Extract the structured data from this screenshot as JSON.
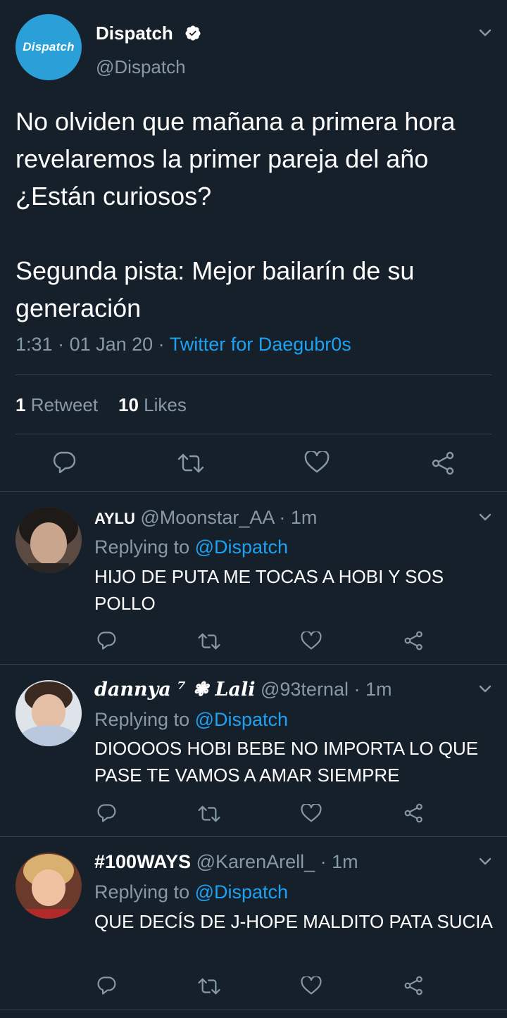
{
  "tweet": {
    "author_name": "Dispatch",
    "author_handle": "@Dispatch",
    "avatar_text": "Dispatch",
    "paragraph1": "No olviden que mañana a primera hora revelaremos la primer pareja del año ¿Están curiosos?",
    "paragraph2": "Segunda pista: Mejor bailarín de su generación",
    "time": "1:31",
    "date": "01 Jan 20",
    "source": "Twitter for Daegubr0s",
    "retweet_count": "1",
    "retweet_label": "Retweet",
    "like_count": "10",
    "like_label": "Likes"
  },
  "replies": [
    {
      "name": "AYLU",
      "handle": "@Moonstar_AA",
      "time": "1m",
      "replying_prefix": "Replying to",
      "replying_to": "@Dispatch",
      "text": "HIJO DE PUTA ME TOCAS A HOBI Y SOS POLLO"
    },
    {
      "name": "dannya ⁷ ❃ Lali",
      "handle": "@93ternal",
      "time": "1m",
      "replying_prefix": "Replying to",
      "replying_to": "@Dispatch",
      "text": "DIOOOOS HOBI BEBE NO IMPORTA LO QUE PASE TE VAMOS A AMAR SIEMPRE"
    },
    {
      "name": "#100WAYS",
      "handle": "@KarenArell_",
      "time": "1m",
      "replying_prefix": "Replying to",
      "replying_to": "@Dispatch",
      "text": "QUE DECÍS DE J-HOPE MALDITO PATA SUCIA"
    }
  ],
  "colors": {
    "background": "#15202b",
    "muted": "#8899a6",
    "accent": "#1da1f2",
    "divider": "#38444d"
  },
  "icons": [
    "chevron-down-icon",
    "verified-icon",
    "reply-icon",
    "retweet-icon",
    "like-icon",
    "share-icon"
  ]
}
